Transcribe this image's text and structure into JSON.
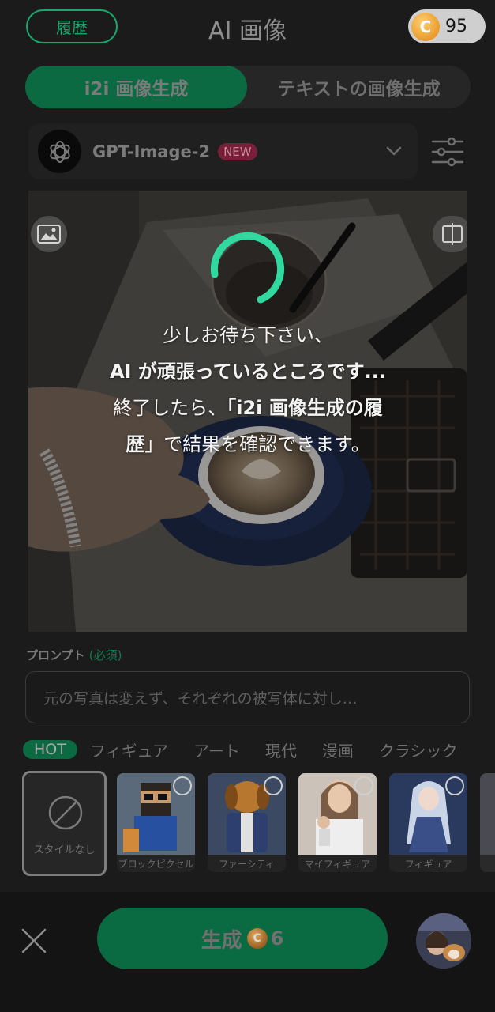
{
  "header": {
    "history_label": "履歴",
    "title": "AI 画像",
    "credits": "95",
    "coin_symbol": "C"
  },
  "mode_tabs": [
    {
      "label": "i2i 画像生成",
      "active": true
    },
    {
      "label": "テキストの画像生成",
      "active": false
    }
  ],
  "model": {
    "name": "GPT-Image-2",
    "badge": "NEW",
    "icon": "openai-logo-icon"
  },
  "loading": {
    "line1": "少しお待ち下さい、",
    "line2": "AI が頑張っているところです...",
    "line3_a": "終了したら、",
    "line3_b": "「i2i 画像生成の履",
    "line4_a": "歴",
    "line4_b": "」で結果を確認できます。",
    "spinner_color": "#2fd9a0"
  },
  "prompt": {
    "label": "プロンプト",
    "required": "(必須)",
    "value": "元の写真は変えず、それぞれの被写体に対し…"
  },
  "categories": [
    "HOT",
    "フィギュア",
    "アート",
    "現代",
    "漫画",
    "クラシック"
  ],
  "styles": {
    "none_label": "スタイルなし",
    "items": [
      {
        "label": "ブロックピクセル"
      },
      {
        "label": "ファーシティ"
      },
      {
        "label": "マイフィギュア"
      },
      {
        "label": "フィギュア"
      }
    ]
  },
  "footer": {
    "generate_label": "生成",
    "coin_symbol": "C",
    "cost": "6"
  },
  "colors": {
    "accent": "#17a86d",
    "accent_dark": "#0a6b43",
    "background": "#1b1b1b"
  }
}
